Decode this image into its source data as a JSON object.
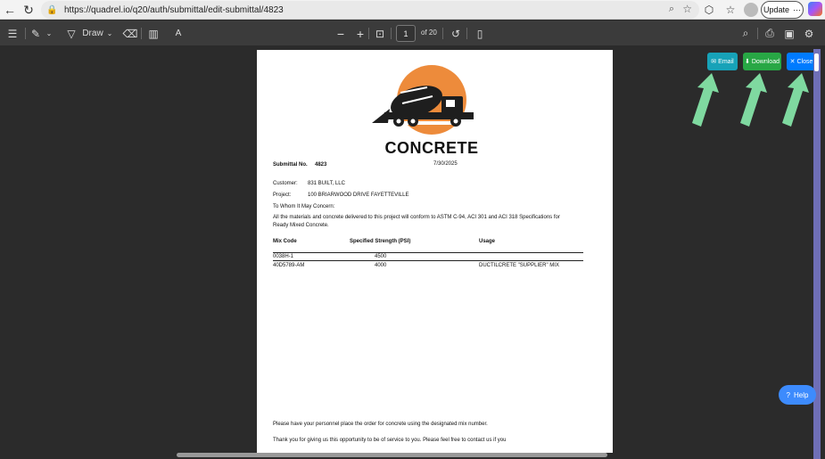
{
  "browser": {
    "url": "https://quadrel.io/q20/auth/submittal/edit-submittal/4823",
    "update_label": "Update"
  },
  "pdf_toolbar": {
    "draw_label": "Draw",
    "current_page": "1",
    "page_count": "of 20"
  },
  "document": {
    "logo_text": "CONCRETE",
    "submittal_label": "Submittal No.",
    "submittal_no": "4823",
    "date": "7/30/2025",
    "customer_label": "Customer:",
    "customer_value": "831 BUILT, LLC",
    "project_label": "Project:",
    "project_value": "100 BRIARWOOD DRIVE FAYETTEVILLE",
    "greeting": "To Whom It May Concern:",
    "body_line1": "All the materials and concrete delivered to this project will conform to ASTM C-94, ACI 301 and ACI 318 Specifications for",
    "body_line2": "Ready Mixed Concrete.",
    "table_headers": [
      "Mix Code",
      "Specified Strength (PSI)",
      "Usage"
    ],
    "rows": [
      {
        "code": "0038H-1",
        "strength": "4500",
        "usage": ""
      },
      {
        "code": "40D5789-AM",
        "strength": "4000",
        "usage": "DUCTILCRETE \"SUPPLIER\" MIX"
      }
    ],
    "footer_line1": "Please have your personnel place the order for concrete using the designated mix number.",
    "footer_line2": "Thank you for giving us this opportunity to be of service to you.  Please feel free to contact us if you"
  },
  "actions": {
    "email_label": "Email",
    "download_label": "Download",
    "close_label": "Close",
    "email_color": "#17a2b8",
    "download_color": "#28a745",
    "close_color": "#007bff",
    "arrow_color": "#7fd9a0"
  },
  "help_label": "Help"
}
